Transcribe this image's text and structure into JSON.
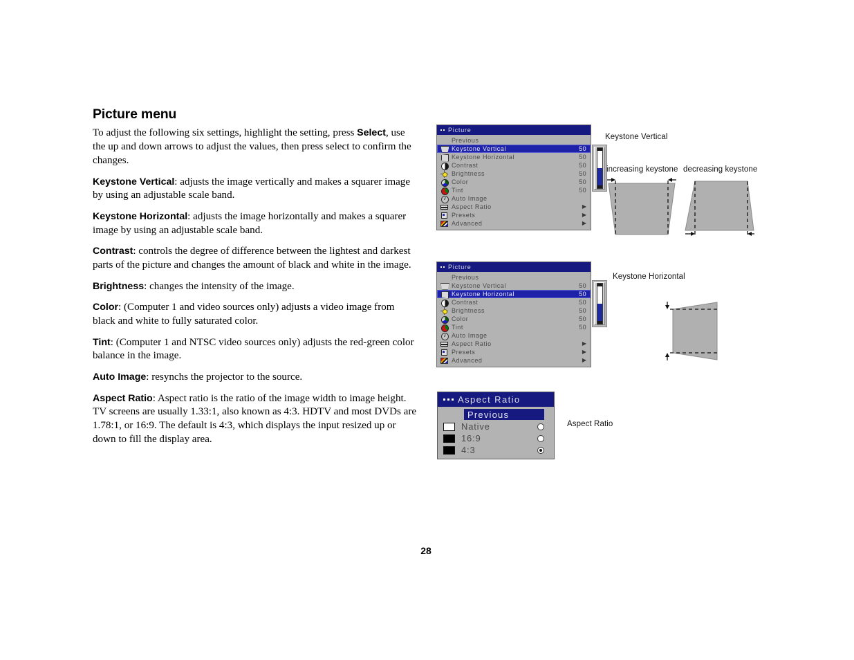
{
  "page": {
    "title": "Picture menu",
    "number": "28"
  },
  "body_paragraphs": [
    {
      "id": "intro",
      "runs": [
        {
          "t": "To adjust the following six settings, highlight the setting, press ",
          "b": false
        },
        {
          "t": "Select",
          "b": true
        },
        {
          "t": ", use the up and down arrows to adjust the values, then press select to confirm the changes.",
          "b": false
        }
      ]
    },
    {
      "id": "keystone-vertical",
      "runs": [
        {
          "t": "Keystone Vertical",
          "b": true
        },
        {
          "t": ": adjusts the image vertically and makes a squarer image by using an adjustable scale band.",
          "b": false
        }
      ]
    },
    {
      "id": "keystone-horizontal",
      "runs": [
        {
          "t": "Keystone Horizontal",
          "b": true
        },
        {
          "t": ": adjusts the image horizontally and makes a squarer image by using an adjustable scale band.",
          "b": false
        }
      ]
    },
    {
      "id": "contrast",
      "runs": [
        {
          "t": "Contrast",
          "b": true
        },
        {
          "t": ": controls the degree of difference between the lightest and darkest parts of the picture and changes the amount of black and white in the image.",
          "b": false
        }
      ]
    },
    {
      "id": "brightness",
      "runs": [
        {
          "t": "Brightness",
          "b": true
        },
        {
          "t": ": changes the intensity of the image.",
          "b": false
        }
      ]
    },
    {
      "id": "color",
      "runs": [
        {
          "t": "Color",
          "b": true
        },
        {
          "t": ": (Computer 1 and video sources only) adjusts a video image from black and white to fully saturated color.",
          "b": false
        }
      ]
    },
    {
      "id": "tint",
      "runs": [
        {
          "t": "Tint",
          "b": true
        },
        {
          "t": ": (Computer 1 and NTSC video sources only) adjusts the red-green color balance in the image.",
          "b": false
        }
      ]
    },
    {
      "id": "auto-image",
      "runs": [
        {
          "t": "Auto Image",
          "b": true
        },
        {
          "t": ": resynchs the projector to the source.",
          "b": false
        }
      ]
    },
    {
      "id": "aspect-ratio",
      "runs": [
        {
          "t": "Aspect Ratio",
          "b": true
        },
        {
          "t": ": Aspect ratio is the ratio of the image width to image height. TV screens are usually 1.33:1, also known as 4:3. HDTV and most DVDs are 1.78:1, or 16:9. The default is 4:3, which displays the input resized up or down to fill the display area.",
          "b": false
        }
      ]
    }
  ],
  "osd_menu_1": {
    "title": "Picture",
    "selected_index": 1,
    "items": [
      {
        "icon": "none",
        "label": "Previous",
        "value": "",
        "arrow": false
      },
      {
        "icon": "keystone-vertical-icon",
        "label": "Keystone Vertical",
        "value": "50",
        "arrow": false
      },
      {
        "icon": "keystone-horizontal-icon",
        "label": "Keystone Horizontal",
        "value": "50",
        "arrow": false
      },
      {
        "icon": "contrast-icon",
        "label": "Contrast",
        "value": "50",
        "arrow": false
      },
      {
        "icon": "brightness-icon",
        "label": "Brightness",
        "value": "50",
        "arrow": false
      },
      {
        "icon": "color-icon",
        "label": "Color",
        "value": "50",
        "arrow": false
      },
      {
        "icon": "tint-icon",
        "label": "Tint",
        "value": "50",
        "arrow": false
      },
      {
        "icon": "auto-image-icon",
        "label": "Auto Image",
        "value": "",
        "arrow": false
      },
      {
        "icon": "aspect-ratio-icon",
        "label": "Aspect Ratio",
        "value": "",
        "arrow": true
      },
      {
        "icon": "presets-icon",
        "label": "Presets",
        "value": "",
        "arrow": true
      },
      {
        "icon": "advanced-icon",
        "label": "Advanced",
        "value": "",
        "arrow": true
      }
    ],
    "scale_band": {
      "fill_percent": 50
    }
  },
  "osd_menu_2": {
    "title": "Picture",
    "selected_index": 2,
    "items": [
      {
        "icon": "none",
        "label": "Previous",
        "value": "",
        "arrow": false
      },
      {
        "icon": "keystone-vertical-icon",
        "label": "Keystone Vertical",
        "value": "50",
        "arrow": false
      },
      {
        "icon": "keystone-horizontal-icon",
        "label": "Keystone Horizontal",
        "value": "50",
        "arrow": false
      },
      {
        "icon": "contrast-icon",
        "label": "Contrast",
        "value": "50",
        "arrow": false
      },
      {
        "icon": "brightness-icon",
        "label": "Brightness",
        "value": "50",
        "arrow": false
      },
      {
        "icon": "color-icon",
        "label": "Color",
        "value": "50",
        "arrow": false
      },
      {
        "icon": "tint-icon",
        "label": "Tint",
        "value": "50",
        "arrow": false
      },
      {
        "icon": "auto-image-icon",
        "label": "Auto Image",
        "value": "",
        "arrow": false
      },
      {
        "icon": "aspect-ratio-icon",
        "label": "Aspect Ratio",
        "value": "",
        "arrow": true
      },
      {
        "icon": "presets-icon",
        "label": "Presets",
        "value": "",
        "arrow": true
      },
      {
        "icon": "advanced-icon",
        "label": "Advanced",
        "value": "",
        "arrow": true
      }
    ],
    "scale_band": {
      "fill_percent": 50
    }
  },
  "aspect_ratio_menu": {
    "title": "Aspect Ratio",
    "previous_label": "Previous",
    "options": [
      {
        "label": "Native",
        "swatch": "#ffffff",
        "selected": false
      },
      {
        "label": "16:9",
        "swatch": "#000000",
        "selected": false
      },
      {
        "label": "4:3",
        "swatch": "#000000",
        "selected": true
      }
    ]
  },
  "callouts": {
    "keystone_vertical": "Keystone Vertical",
    "increasing_keystone": "increasing keystone",
    "decreasing_keystone": "decreasing keystone",
    "keystone_horizontal": "Keystone Horizontal",
    "aspect_ratio": "Aspect Ratio"
  },
  "colors": {
    "osd_header_blue": "#161a80",
    "osd_highlight_blue": "#1e22a8",
    "osd_background_gray": "#b3b3b3",
    "diagram_fill_gray": "#b0b0b0",
    "slider_fill_blue": "#1f2a9c"
  }
}
